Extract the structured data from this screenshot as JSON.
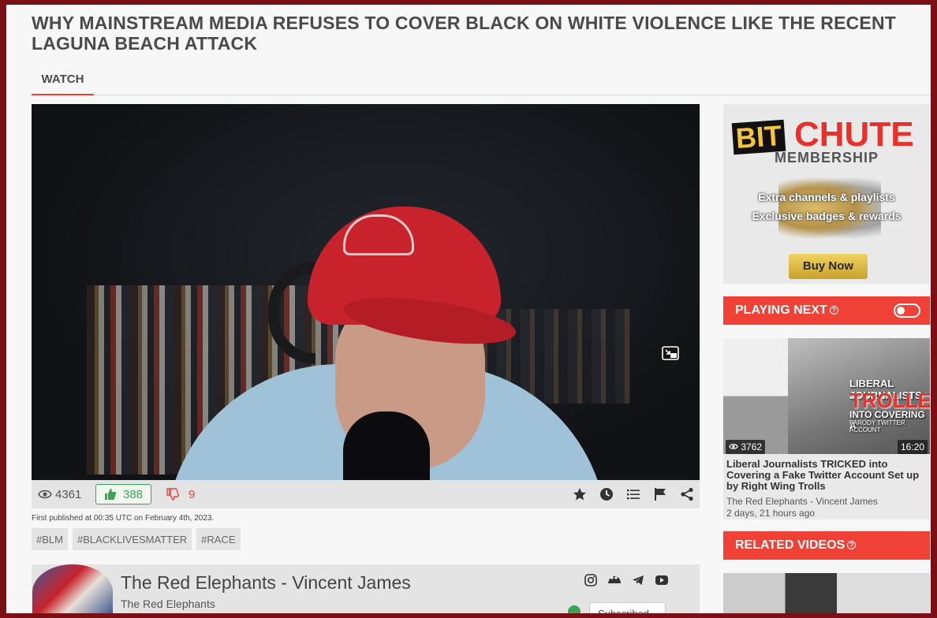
{
  "page": {
    "title": "WHY MAINSTREAM MEDIA REFUSES TO COVER BLACK ON WHITE VIOLENCE LIKE THE RECENT LAGUNA BEACH ATTACK",
    "tabs": [
      {
        "label": "WATCH",
        "active": true
      }
    ]
  },
  "video": {
    "views": "4361",
    "likes": "388",
    "dislikes": "9",
    "published": "First published at 00:35 UTC on February 4th, 2023."
  },
  "tags": [
    "#BLM",
    "#BLACKLIVESMATTER",
    "#RACE"
  ],
  "channel": {
    "name": "The Red Elephants - Vincent James",
    "subtitle": "The Red Elephants",
    "subscribe_label": "Subscribed"
  },
  "ad": {
    "logo_bit": "BIT",
    "logo_chute": "CHUTE",
    "membership": "MEMBERSHIP",
    "line1": "Extra channels & playlists",
    "line2": "Exclusive badges & rewards",
    "buy_label": "Buy Now"
  },
  "playing_next": {
    "heading": "PLAYING NEXT",
    "autoplay_on": false,
    "item": {
      "thumb_line1": "LIBERAL JOURNALISTS",
      "thumb_line2": "TROLLED",
      "thumb_line3": "INTO COVERING A",
      "thumb_line4": "PARODY TWITTER ACCOUNT",
      "views": "3762",
      "duration": "16:20",
      "title": "Liberal Journalists TRICKED into Covering a Fake Twitter Account Set up by Right Wing Trolls",
      "channel": "The Red Elephants - Vincent James",
      "age": "2 days, 21 hours ago"
    }
  },
  "related": {
    "heading": "RELATED VIDEOS"
  },
  "colors": {
    "accent": "#ef4136",
    "like": "#3aa655",
    "dislike": "#e0463c",
    "frame": "#7a0f16"
  }
}
